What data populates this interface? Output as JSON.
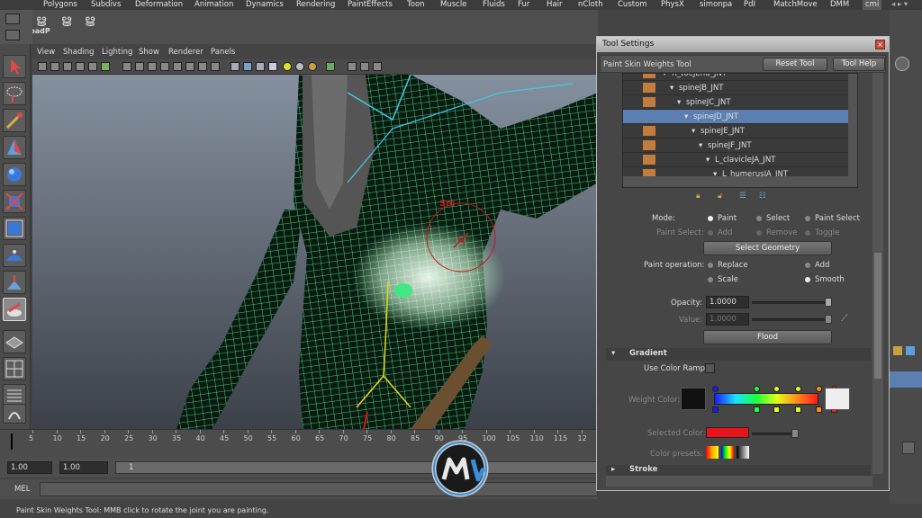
{
  "shelf_tabs": [
    "Polygons",
    "Subdivs",
    "Deformation",
    "Animation",
    "Dynamics",
    "Rendering",
    "PaintEffects",
    "Toon",
    "Muscle",
    "Fluids",
    "Fur",
    "Hair",
    "nCloth",
    "Custom",
    "PhysX",
    "simonpa",
    "PdI",
    "MatchMove",
    "DMM",
    "cmi"
  ],
  "shelf_label": "badP",
  "viewport_menu": [
    "View",
    "Shading",
    "Lighting",
    "Show",
    "Renderer",
    "Panels"
  ],
  "brush_label": "Sm",
  "timeline_ticks": [
    "5",
    "10",
    "15",
    "20",
    "25",
    "30",
    "35",
    "40",
    "45",
    "50",
    "55",
    "60",
    "65",
    "70",
    "75",
    "80",
    "85",
    "90",
    "95",
    "100",
    "105",
    "110",
    "115",
    "12"
  ],
  "range": {
    "start": "1.00",
    "current": "1.00",
    "frame": "1"
  },
  "cmd_label": "MEL",
  "help_text": "Paint Skin Weights Tool: MMB click to rotate the joint you are painting.",
  "tool_settings": {
    "window_title": "Tool Settings",
    "tool_name": "Paint Skin Weights Tool",
    "reset_label": "Reset Tool",
    "help_label": "Tool Help",
    "joints": [
      {
        "label": "R_toeJEnd_JNT",
        "indent": 0
      },
      {
        "label": "spineJB_JNT",
        "indent": 1
      },
      {
        "label": "spineJC_JNT",
        "indent": 2
      },
      {
        "label": "spineJD_JNT",
        "indent": 3,
        "selected": true
      },
      {
        "label": "spineJE_JNT",
        "indent": 4
      },
      {
        "label": "spineJF_JNT",
        "indent": 5
      },
      {
        "label": "L_clavicleJA_JNT",
        "indent": 6
      },
      {
        "label": "L_humerusJA_JNT",
        "indent": 7
      }
    ],
    "mode_label": "Mode:",
    "mode_options": [
      "Paint",
      "Select",
      "Paint Select"
    ],
    "paint_select_label": "Paint Select:",
    "paint_select_options": [
      "Add",
      "Remove",
      "Toggle"
    ],
    "select_geometry_label": "Select Geometry",
    "paint_operation_label": "Paint operation:",
    "paint_operations": [
      "Replace",
      "Add",
      "Scale",
      "Smooth"
    ],
    "paint_operation_selected": "Smooth",
    "opacity_label": "Opacity:",
    "opacity_value": "1.0000",
    "value_label": "Value:",
    "value_value": "1.0000",
    "flood_label": "Flood",
    "gradient_section": "Gradient",
    "use_color_ramp_label": "Use Color Ramp",
    "weight_color_label": "Weight Color:",
    "selected_color_label": "Selected Color:",
    "selected_color": "#e8141c",
    "color_presets_label": "Color presets:",
    "stroke_section": "Stroke"
  },
  "colors": {
    "mesh_wire": "#4cff9a",
    "joint_line": "#46c8e6",
    "brush_ring": "#c81414",
    "swatch_orange": "#c27c3e",
    "selection_blue": "#5b7fb0"
  }
}
